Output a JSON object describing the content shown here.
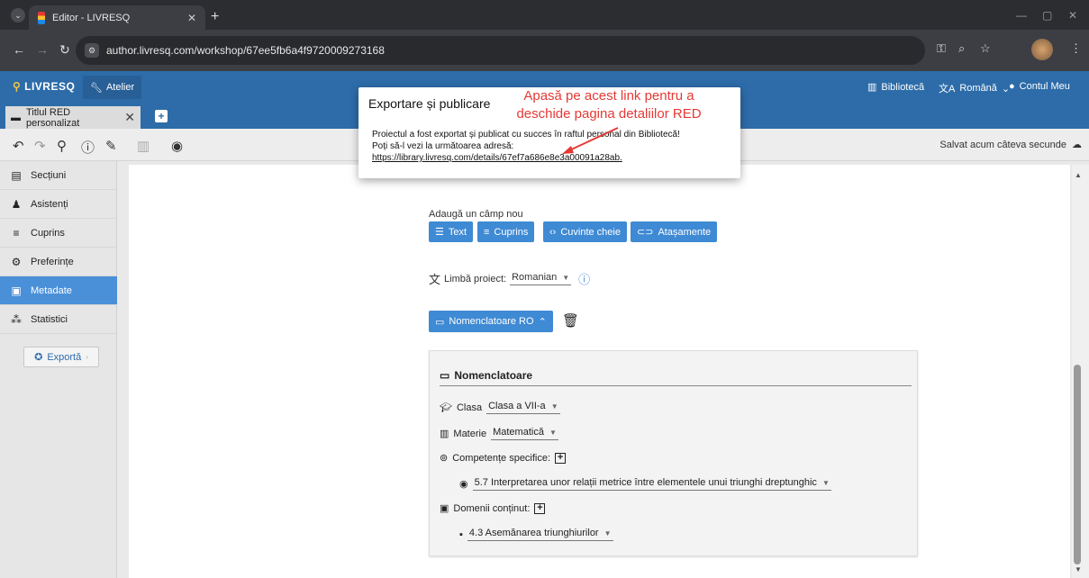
{
  "browser": {
    "tab_title": "Editor - LIVRESQ",
    "url": "author.livresq.com/workshop/67ee5fb6a4f9720009273168"
  },
  "app": {
    "logo": "LIVRESQ",
    "atelier": "Atelier",
    "biblioteca": "Bibliotecă",
    "language": "Română",
    "account": "Contul Meu",
    "doc_tab": "Titlul RED personalizat",
    "saved_status": "Salvat acum câteva secunde"
  },
  "sidebar": {
    "items": [
      {
        "label": "Secțiuni",
        "icon": "document-icon"
      },
      {
        "label": "Asistenți",
        "icon": "person-icon"
      },
      {
        "label": "Cuprins",
        "icon": "list-icon"
      },
      {
        "label": "Preferințe",
        "icon": "gear-icon"
      },
      {
        "label": "Metadate",
        "icon": "metadata-icon"
      },
      {
        "label": "Statistici",
        "icon": "chart-icon"
      }
    ],
    "active_index": 4,
    "export_label": "Exportă"
  },
  "main": {
    "add_field_label": "Adaugă un câmp nou",
    "add_buttons": [
      "Text",
      "Cuprins",
      "Cuvinte cheie",
      "Atașamente"
    ],
    "project_language_label": "Limbă proiect:",
    "project_language_value": "Romanian",
    "nomenclatoare_button": "Nomenclatoare RO",
    "card": {
      "title": "Nomenclatoare",
      "clasa_label": "Clasa",
      "clasa_value": "Clasa a VII-a",
      "materie_label": "Materie",
      "materie_value": "Matematică",
      "competente_label": "Competențe specifice:",
      "competenta_value": "5.7 Interpretarea unor relații metrice între elementele unui triunghi dreptunghic",
      "domenii_label": "Domenii conținut:",
      "domeniu_value": "4.3 Asemănarea triunghiurilor"
    }
  },
  "dialog": {
    "title": "Exportare și publicare",
    "line1": "Proiectul a fost exportat și publicat cu succes în raftul personal din Bibliotecă!",
    "line2": "Poți să-l vezi la următoarea adresă:",
    "link": "https://library.livresq.com/details/67ef7a686e8e3a00091a28ab."
  },
  "annotation": {
    "text_line1": "Apasă pe acest link pentru a",
    "text_line2": "deschide pagina detaliilor RED",
    "color": "#e53935"
  },
  "colors": {
    "header_blue": "#2d6ca9",
    "button_blue": "#3f8ad4",
    "active_sidebar": "#4a90d9"
  }
}
